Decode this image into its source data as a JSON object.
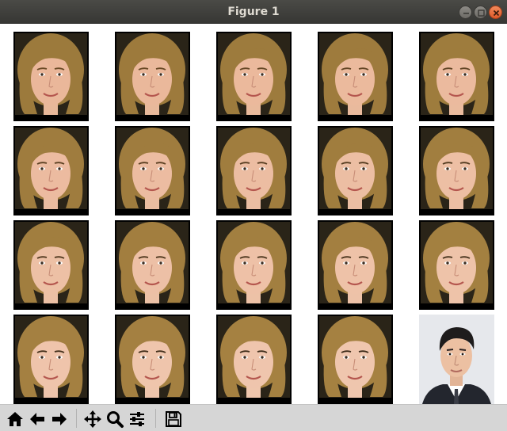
{
  "window": {
    "title": "Figure 1",
    "controls": [
      "minimize-icon",
      "maximize-icon",
      "close-icon"
    ]
  },
  "figure": {
    "grid": {
      "rows": 4,
      "cols": 5
    },
    "tiles": [
      {
        "subject": "woman-portrait",
        "blend": 0.0
      },
      {
        "subject": "woman-portrait",
        "blend": 0.05
      },
      {
        "subject": "woman-portrait",
        "blend": 0.1
      },
      {
        "subject": "woman-portrait",
        "blend": 0.15
      },
      {
        "subject": "woman-portrait",
        "blend": 0.2
      },
      {
        "subject": "woman-portrait",
        "blend": 0.25
      },
      {
        "subject": "woman-portrait",
        "blend": 0.3
      },
      {
        "subject": "woman-portrait",
        "blend": 0.35
      },
      {
        "subject": "woman-portrait",
        "blend": 0.4
      },
      {
        "subject": "woman-portrait",
        "blend": 0.45
      },
      {
        "subject": "woman-portrait",
        "blend": 0.5
      },
      {
        "subject": "woman-portrait",
        "blend": 0.55
      },
      {
        "subject": "woman-portrait",
        "blend": 0.6
      },
      {
        "subject": "woman-portrait",
        "blend": 0.65
      },
      {
        "subject": "woman-portrait",
        "blend": 0.7
      },
      {
        "subject": "woman-portrait",
        "blend": 0.75
      },
      {
        "subject": "woman-portrait",
        "blend": 0.8
      },
      {
        "subject": "woman-portrait",
        "blend": 0.85
      },
      {
        "subject": "woman-portrait",
        "blend": 0.9
      },
      {
        "subject": "man-portrait",
        "blend": 1.0
      }
    ],
    "colors": {
      "background": "#ffffff",
      "tile_frame": "#000000",
      "hair": "#9c7a3c",
      "skin": "#f0c8b0",
      "man_background": "#e6e8ec",
      "man_hair": "#1e1c1c",
      "man_suit": "#23262e",
      "man_shirt": "#ffffff"
    }
  },
  "toolbar": {
    "buttons": [
      {
        "name": "home-button",
        "icon": "home-icon"
      },
      {
        "name": "back-button",
        "icon": "arrow-left-icon"
      },
      {
        "name": "forward-button",
        "icon": "arrow-right-icon"
      },
      {
        "name": "pan-button",
        "icon": "move-icon"
      },
      {
        "name": "zoom-button",
        "icon": "zoom-icon"
      },
      {
        "name": "configure-subplots-button",
        "icon": "sliders-icon"
      },
      {
        "name": "save-button",
        "icon": "save-icon"
      }
    ],
    "colors": {
      "background": "#d6d6d6",
      "icon": "#000000"
    }
  }
}
